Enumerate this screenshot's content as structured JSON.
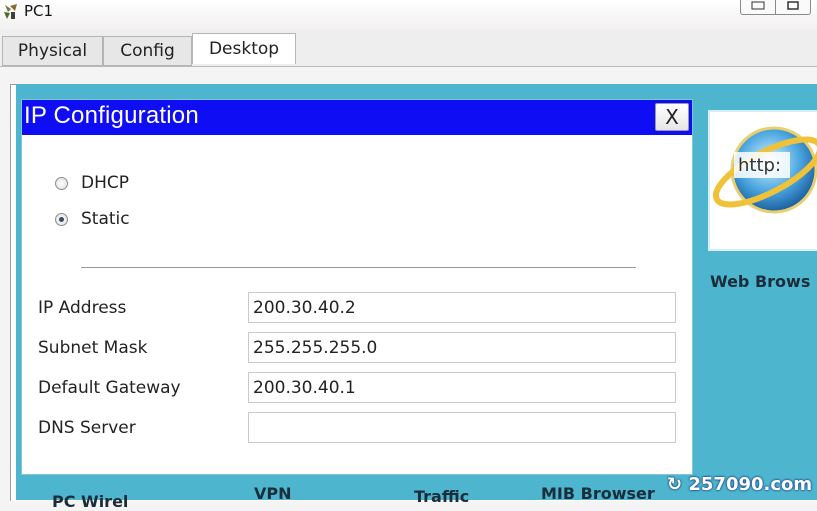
{
  "window": {
    "title": "PC1"
  },
  "tabs": [
    {
      "label": "Physical"
    },
    {
      "label": "Config"
    },
    {
      "label": "Desktop"
    }
  ],
  "dialog": {
    "title": "IP Configuration",
    "close_label": "X",
    "mode_options": [
      {
        "label": "DHCP",
        "selected": false
      },
      {
        "label": "Static",
        "selected": true
      }
    ],
    "fields": {
      "ip_address": {
        "label": "IP Address",
        "value": "200.30.40.2"
      },
      "subnet_mask": {
        "label": "Subnet Mask",
        "value": "255.255.255.0"
      },
      "default_gateway": {
        "label": "Default Gateway",
        "value": "200.30.40.1"
      },
      "dns_server": {
        "label": "DNS Server",
        "value": ""
      }
    }
  },
  "desktop_apps": {
    "web_browser": {
      "label": "Web Brows",
      "icon_text": "http:"
    },
    "bottom_row": [
      "PC Wirel",
      "VPN",
      "Traffic",
      "MIB Browser"
    ]
  },
  "watermark": {
    "text": "257090.com"
  },
  "colors": {
    "dialog_titlebar": "#0e0df3",
    "desktop_background": "#4db6ce"
  }
}
